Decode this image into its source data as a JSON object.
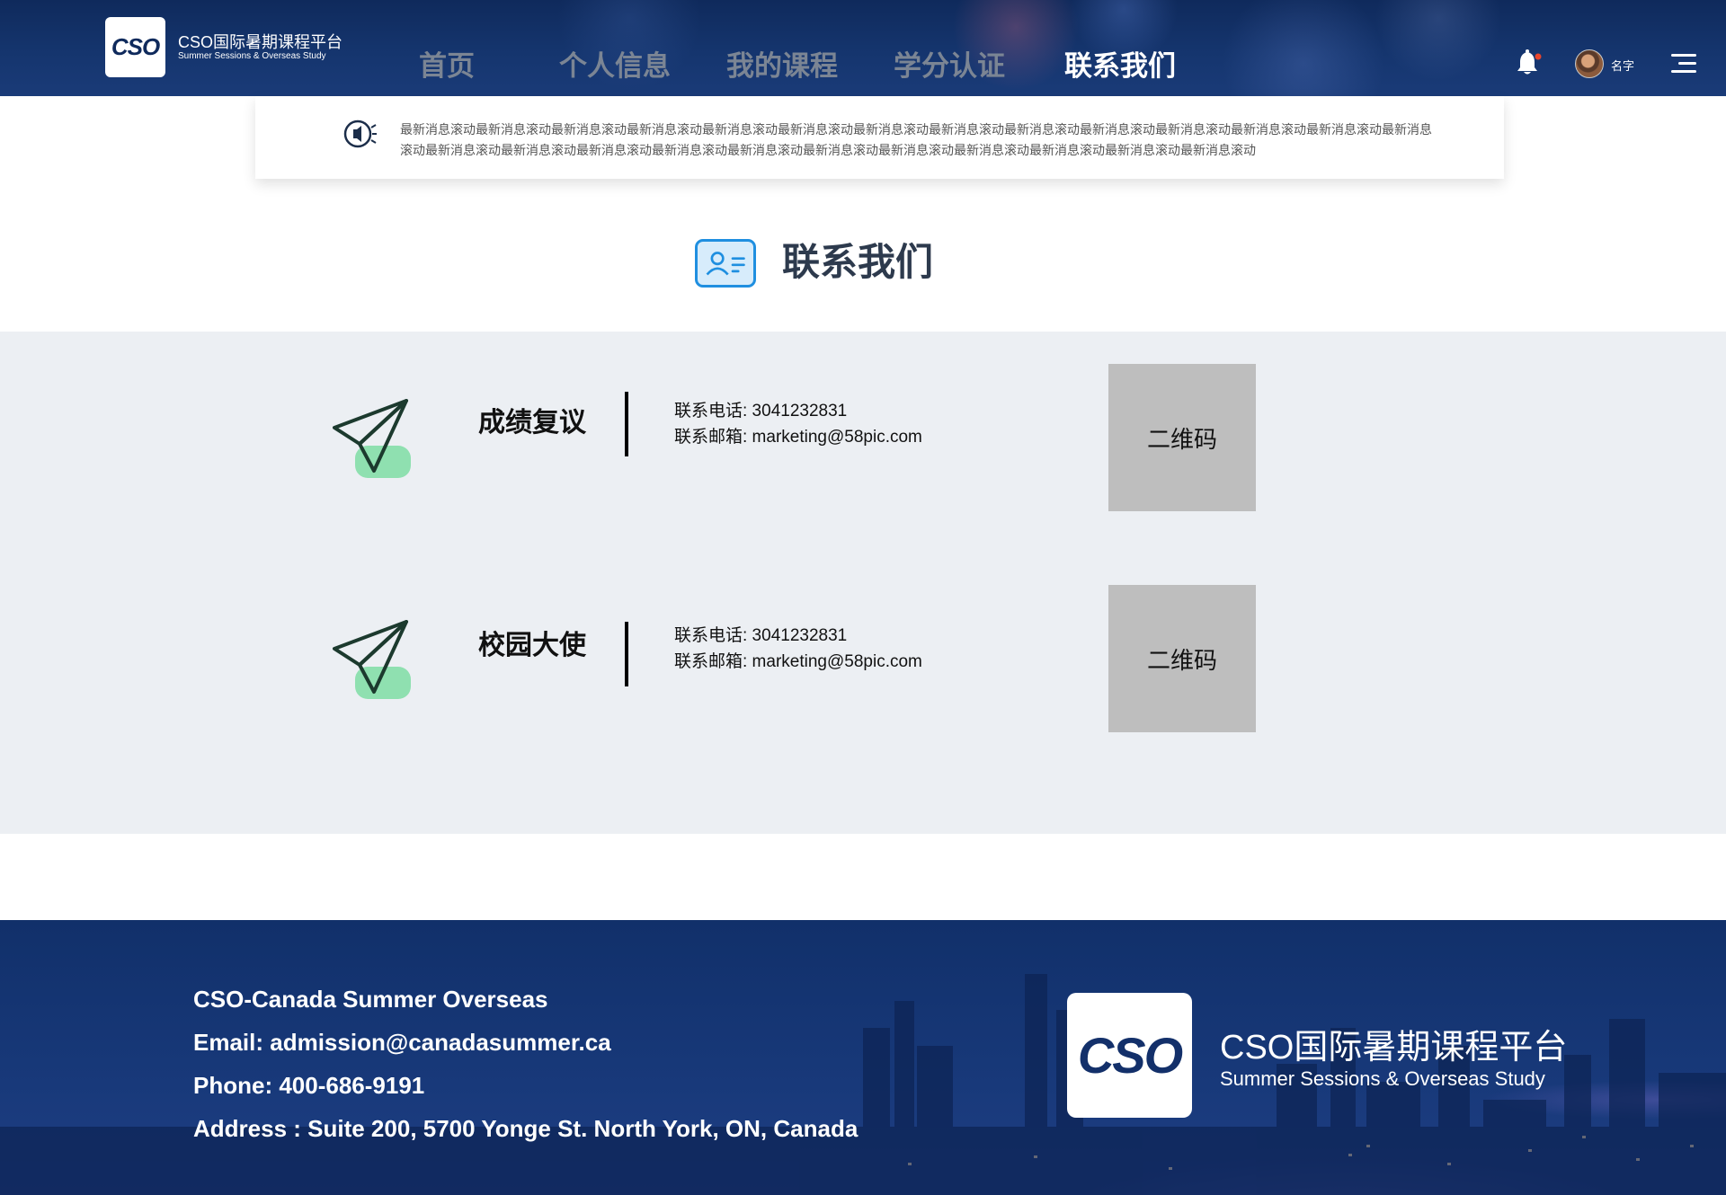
{
  "header": {
    "logo_mark": "CSO",
    "logo_title": "CSO国际暑期课程平台",
    "logo_subtitle": "Summer Sessions & Overseas Study",
    "nav": [
      {
        "label": "首页"
      },
      {
        "label": "个人信息"
      },
      {
        "label": "我的课程"
      },
      {
        "label": "学分认证"
      },
      {
        "label": "联系我们",
        "active": true
      }
    ],
    "user_name": "名字",
    "notification_dot_color": "#e8452c"
  },
  "ticker": {
    "icon": "speaker-icon",
    "text": "最新消息滚动最新消息滚动最新消息滚动最新消息滚动最新消息滚动最新消息滚动最新消息滚动最新消息滚动最新消息滚动最新消息滚动最新消息滚动最新消息滚动最新消息滚动最新消息滚动最新消息滚动最新消息滚动最新消息滚动最新消息滚动最新消息滚动最新消息滚动最新消息滚动最新消息滚动最新消息滚动最新消息滚动最新消息滚动"
  },
  "title": {
    "icon": "contact-card-icon",
    "text": "联系我们"
  },
  "contacts": [
    {
      "icon": "paper-plane-icon",
      "title": "成绩复议",
      "phone": "联系电话: 3041232831",
      "email": "联系邮箱: marketing@58pic.com",
      "qr_label": "二维码"
    },
    {
      "icon": "paper-plane-icon",
      "title": "校园大使",
      "phone": "联系电话: 3041232831",
      "email": "联系邮箱: marketing@58pic.com",
      "qr_label": "二维码"
    }
  ],
  "footer": {
    "lines": [
      "CSO-Canada Summer Overseas",
      "Email: admission@canadasummer.ca",
      "Phone: 400-686-9191",
      "Address : Suite 200, 5700 Yonge St. North York, ON, Canada"
    ],
    "logo_mark": "CSO",
    "logo_title": "CSO国际暑期课程平台",
    "logo_subtitle": "Summer Sessions & Overseas Study"
  },
  "colors": {
    "header_bg": "#15356e",
    "nav_inactive": "#7b8594",
    "accent_blue": "#1f8fe0",
    "plane_stroke": "#1c3a2e",
    "plane_fill": "#8fe0b0",
    "qr_bg": "#bebebe",
    "section_bg": "#eceff3"
  }
}
